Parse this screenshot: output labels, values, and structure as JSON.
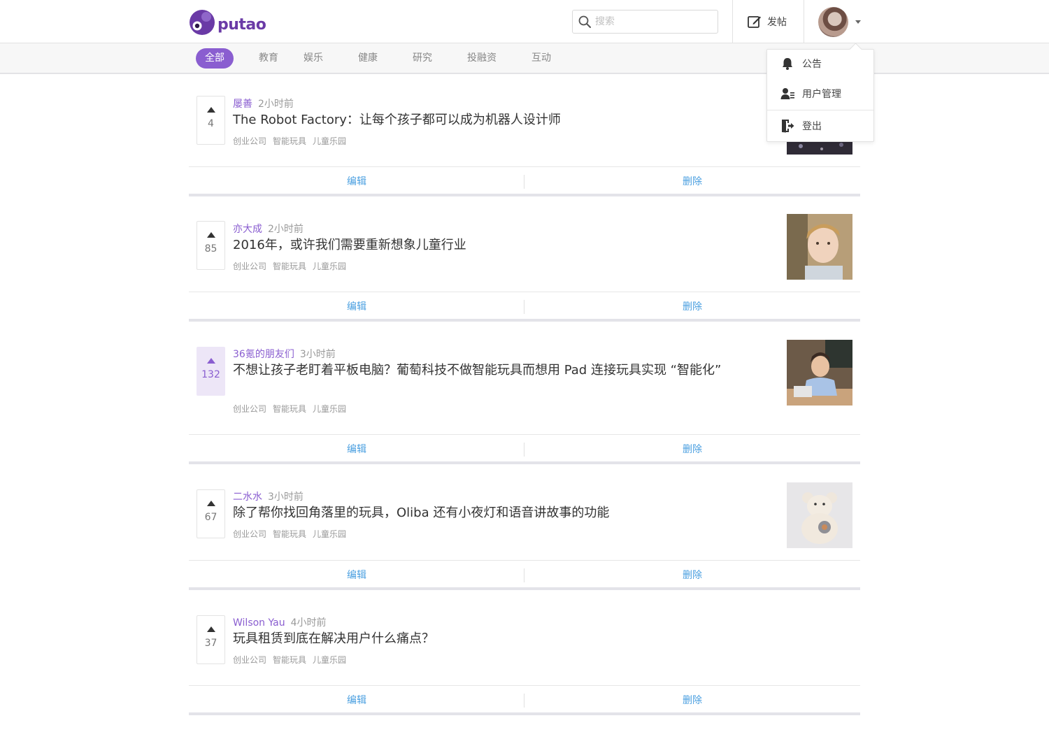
{
  "brand": {
    "name": "putao",
    "color": "#6a3aa6",
    "accent": "#8a5ed0"
  },
  "search": {
    "placeholder": "搜索"
  },
  "header": {
    "post_label": "发帖"
  },
  "nav": {
    "tabs": [
      {
        "label": "全部"
      },
      {
        "label": "教育"
      },
      {
        "label": "娱乐"
      },
      {
        "label": "健康"
      },
      {
        "label": "研究"
      },
      {
        "label": "投融资"
      },
      {
        "label": "互动"
      }
    ]
  },
  "user_menu": {
    "items": [
      {
        "label": "公告"
      },
      {
        "label": "用户管理"
      },
      {
        "label": "登出"
      }
    ]
  },
  "actions": {
    "edit": "编辑",
    "delete": "删除"
  },
  "posts": [
    {
      "votes": "4",
      "voted": false,
      "author": "屡善",
      "time": "2小时前",
      "title": "The Robot Factory：让每个孩子都可以成为机器人设计师",
      "tags": [
        "创业公司",
        "智能玩具",
        "儿童乐园"
      ]
    },
    {
      "votes": "85",
      "voted": false,
      "author": "亦大成",
      "time": "2小时前",
      "title": "2016年，或许我们需要重新想象儿童行业",
      "tags": [
        "创业公司",
        "智能玩具",
        "儿童乐园"
      ]
    },
    {
      "votes": "132",
      "voted": true,
      "author": "36氪的朋友们",
      "time": "3小时前",
      "title": "不想让孩子老盯着平板电脑？葡萄科技不做智能玩具而想用 Pad 连接玩具实现 “智能化”",
      "tags": [
        "创业公司",
        "智能玩具",
        "儿童乐园"
      ]
    },
    {
      "votes": "67",
      "voted": false,
      "author": "二水水",
      "time": "3小时前",
      "title": "除了帮你找回角落里的玩具，Oliba 还有小夜灯和语音讲故事的功能",
      "tags": [
        "创业公司",
        "智能玩具",
        "儿童乐园"
      ]
    },
    {
      "votes": "37",
      "voted": false,
      "author": "Wilson Yau",
      "time": "4小时前",
      "title": "玩具租赁到底在解决用户什么痛点？",
      "tags": [
        "创业公司",
        "智能玩具",
        "儿童乐园"
      ]
    }
  ]
}
